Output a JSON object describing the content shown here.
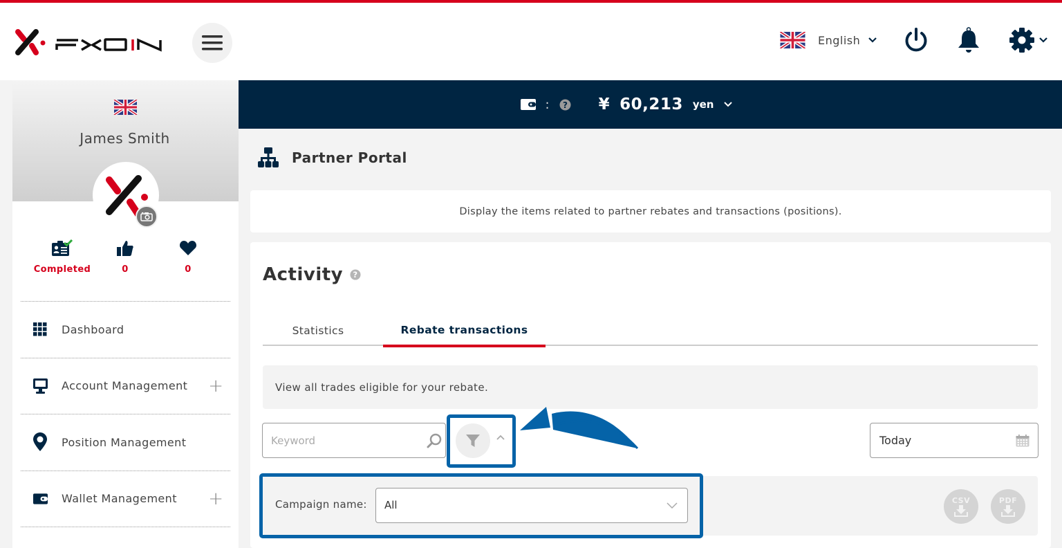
{
  "header": {
    "brand": "FXON",
    "language": "English",
    "colors": {
      "accent_red": "#d6001c",
      "navy": "#002542",
      "highlight_blue": "#0563a8"
    }
  },
  "balance": {
    "separator": ":",
    "currency_symbol": "¥",
    "amount": "60,213",
    "unit": "yen"
  },
  "sidebar": {
    "user_name": "James Smith",
    "stats": [
      {
        "label": "Completed",
        "icon": "id-card-check-icon"
      },
      {
        "label": "0",
        "icon": "thumbs-up-icon"
      },
      {
        "label": "0",
        "icon": "heart-icon"
      }
    ],
    "nav_items": [
      {
        "label": "Dashboard",
        "icon": "grid-icon",
        "expandable": false
      },
      {
        "label": "Account Management",
        "icon": "monitor-icon",
        "expandable": true
      },
      {
        "label": "Position Management",
        "icon": "map-pin-icon",
        "expandable": false
      },
      {
        "label": "Wallet Management",
        "icon": "wallet-icon",
        "expandable": true
      }
    ],
    "plus_glyph": "+"
  },
  "page": {
    "title": "Partner Portal",
    "description": "Display the items related to partner rebates and transactions (positions)."
  },
  "activity": {
    "title": "Activity",
    "tabs": [
      {
        "label": "Statistics",
        "active": false
      },
      {
        "label": "Rebate transactions",
        "active": true
      }
    ],
    "info": "View all trades eligible for your rebate.",
    "keyword_placeholder": "Keyword",
    "keyword_value": "",
    "date_value": "Today",
    "campaign_label": "Campaign name:",
    "campaign_value": "All",
    "export_buttons": [
      {
        "label": "CSV"
      },
      {
        "label": "PDF"
      }
    ]
  }
}
